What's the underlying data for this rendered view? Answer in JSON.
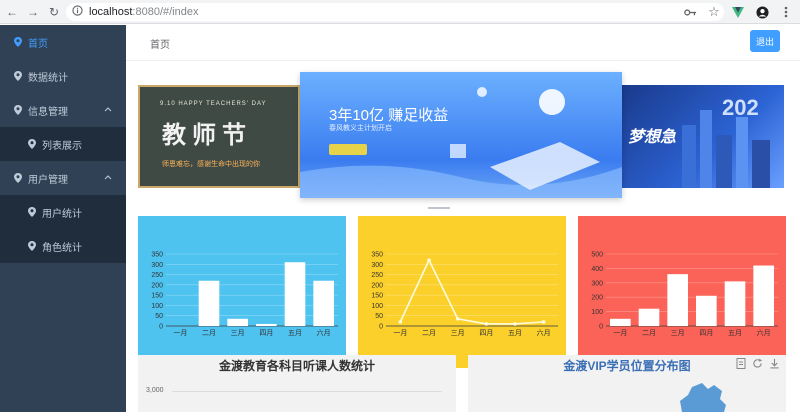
{
  "browser": {
    "url_host": "localhost",
    "url_path": ":8080/#/index"
  },
  "sidebar": {
    "items": [
      {
        "label": "首页",
        "active": true
      },
      {
        "label": "数据统计"
      },
      {
        "label": "信息管理",
        "expandable": true
      },
      {
        "label": "列表展示",
        "sub": true
      },
      {
        "label": "用户管理",
        "expandable": true
      },
      {
        "label": "用户统计",
        "sub": true
      },
      {
        "label": "角色统计",
        "sub": true
      }
    ]
  },
  "header": {
    "breadcrumb": "首页",
    "logout_label": "退出"
  },
  "carousel": {
    "center_title": "3年10亿  赚足收益",
    "center_subtitle": "春风教义主计划开启",
    "left_line": "9.10 HAPPY TEACHERS' DAY",
    "left_big": "教师节",
    "left_bottom": "师恩难忘，感谢生命中出现的你",
    "right_text": "梦想急"
  },
  "colors": {
    "sidebar_bg": "#304156",
    "accent": "#409eff",
    "card_blue": "#4fc3f0",
    "card_yellow": "#fcd02b",
    "card_red": "#fc6358"
  },
  "chart_data": [
    {
      "type": "bar",
      "categories": [
        "一月",
        "二月",
        "三月",
        "四月",
        "五月",
        "六月"
      ],
      "values": [
        0,
        220,
        35,
        10,
        310,
        220
      ],
      "ylim": [
        0,
        350
      ],
      "yticks": [
        0,
        50,
        100,
        150,
        200,
        250,
        300,
        350
      ]
    },
    {
      "type": "line",
      "categories": [
        "一月",
        "二月",
        "三月",
        "四月",
        "五月",
        "六月"
      ],
      "values": [
        20,
        320,
        35,
        10,
        10,
        20
      ],
      "ylim": [
        0,
        350
      ],
      "yticks": [
        0,
        50,
        100,
        150,
        200,
        250,
        300,
        350
      ]
    },
    {
      "type": "bar",
      "categories": [
        "一月",
        "二月",
        "三月",
        "四月",
        "五月",
        "六月"
      ],
      "values": [
        50,
        120,
        360,
        210,
        310,
        420
      ],
      "ylim": [
        0,
        500
      ],
      "yticks": [
        0,
        100,
        200,
        300,
        400,
        500
      ]
    }
  ],
  "panels": {
    "left_title": "金渡教育各科目听课人数统计",
    "left_tick": "3,000",
    "right_title": "金渡VIP学员位置分布图"
  }
}
